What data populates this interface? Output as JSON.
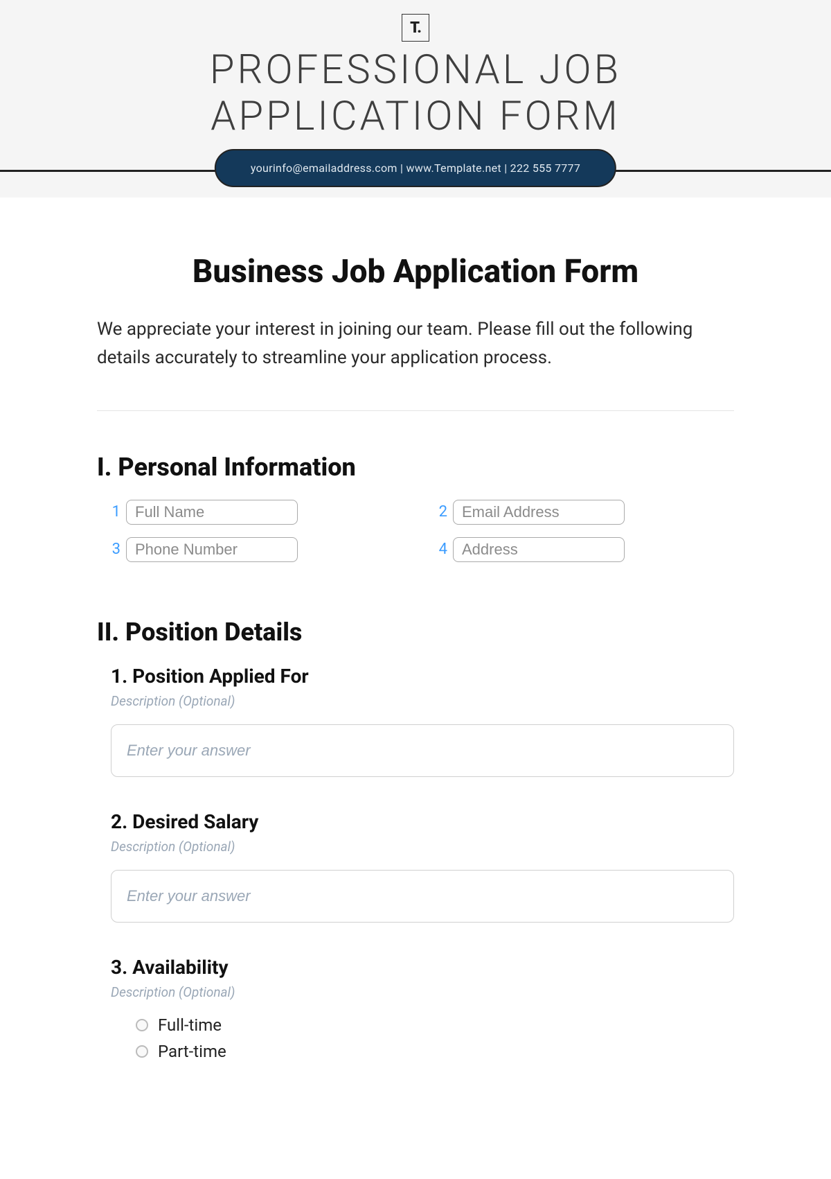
{
  "header": {
    "logo_text": "T.",
    "title_line1": "PROFESSIONAL JOB",
    "title_line2": "APPLICATION FORM",
    "contact_line": "yourinfo@emailaddress.com   |   www.Template.net   |   222 555 7777"
  },
  "form": {
    "title": "Business Job Application Form",
    "intro": "We appreciate your interest in joining our team. Please fill out the following details accurately to streamline your application process."
  },
  "section1": {
    "heading": "I. Personal Information",
    "fields": [
      {
        "num": "1",
        "placeholder": "Full Name"
      },
      {
        "num": "2",
        "placeholder": "Email Address"
      },
      {
        "num": "3",
        "placeholder": "Phone Number"
      },
      {
        "num": "4",
        "placeholder": "Address"
      }
    ]
  },
  "section2": {
    "heading": "II. Position Details",
    "q1": {
      "title": "1. Position Applied For",
      "desc": "Description (Optional)",
      "placeholder": "Enter your answer"
    },
    "q2": {
      "title": "2. Desired Salary",
      "desc": "Description (Optional)",
      "placeholder": "Enter your answer"
    },
    "q3": {
      "title": "3. Availability",
      "desc": "Description (Optional)",
      "options": [
        "Full-time",
        "Part-time"
      ]
    }
  }
}
